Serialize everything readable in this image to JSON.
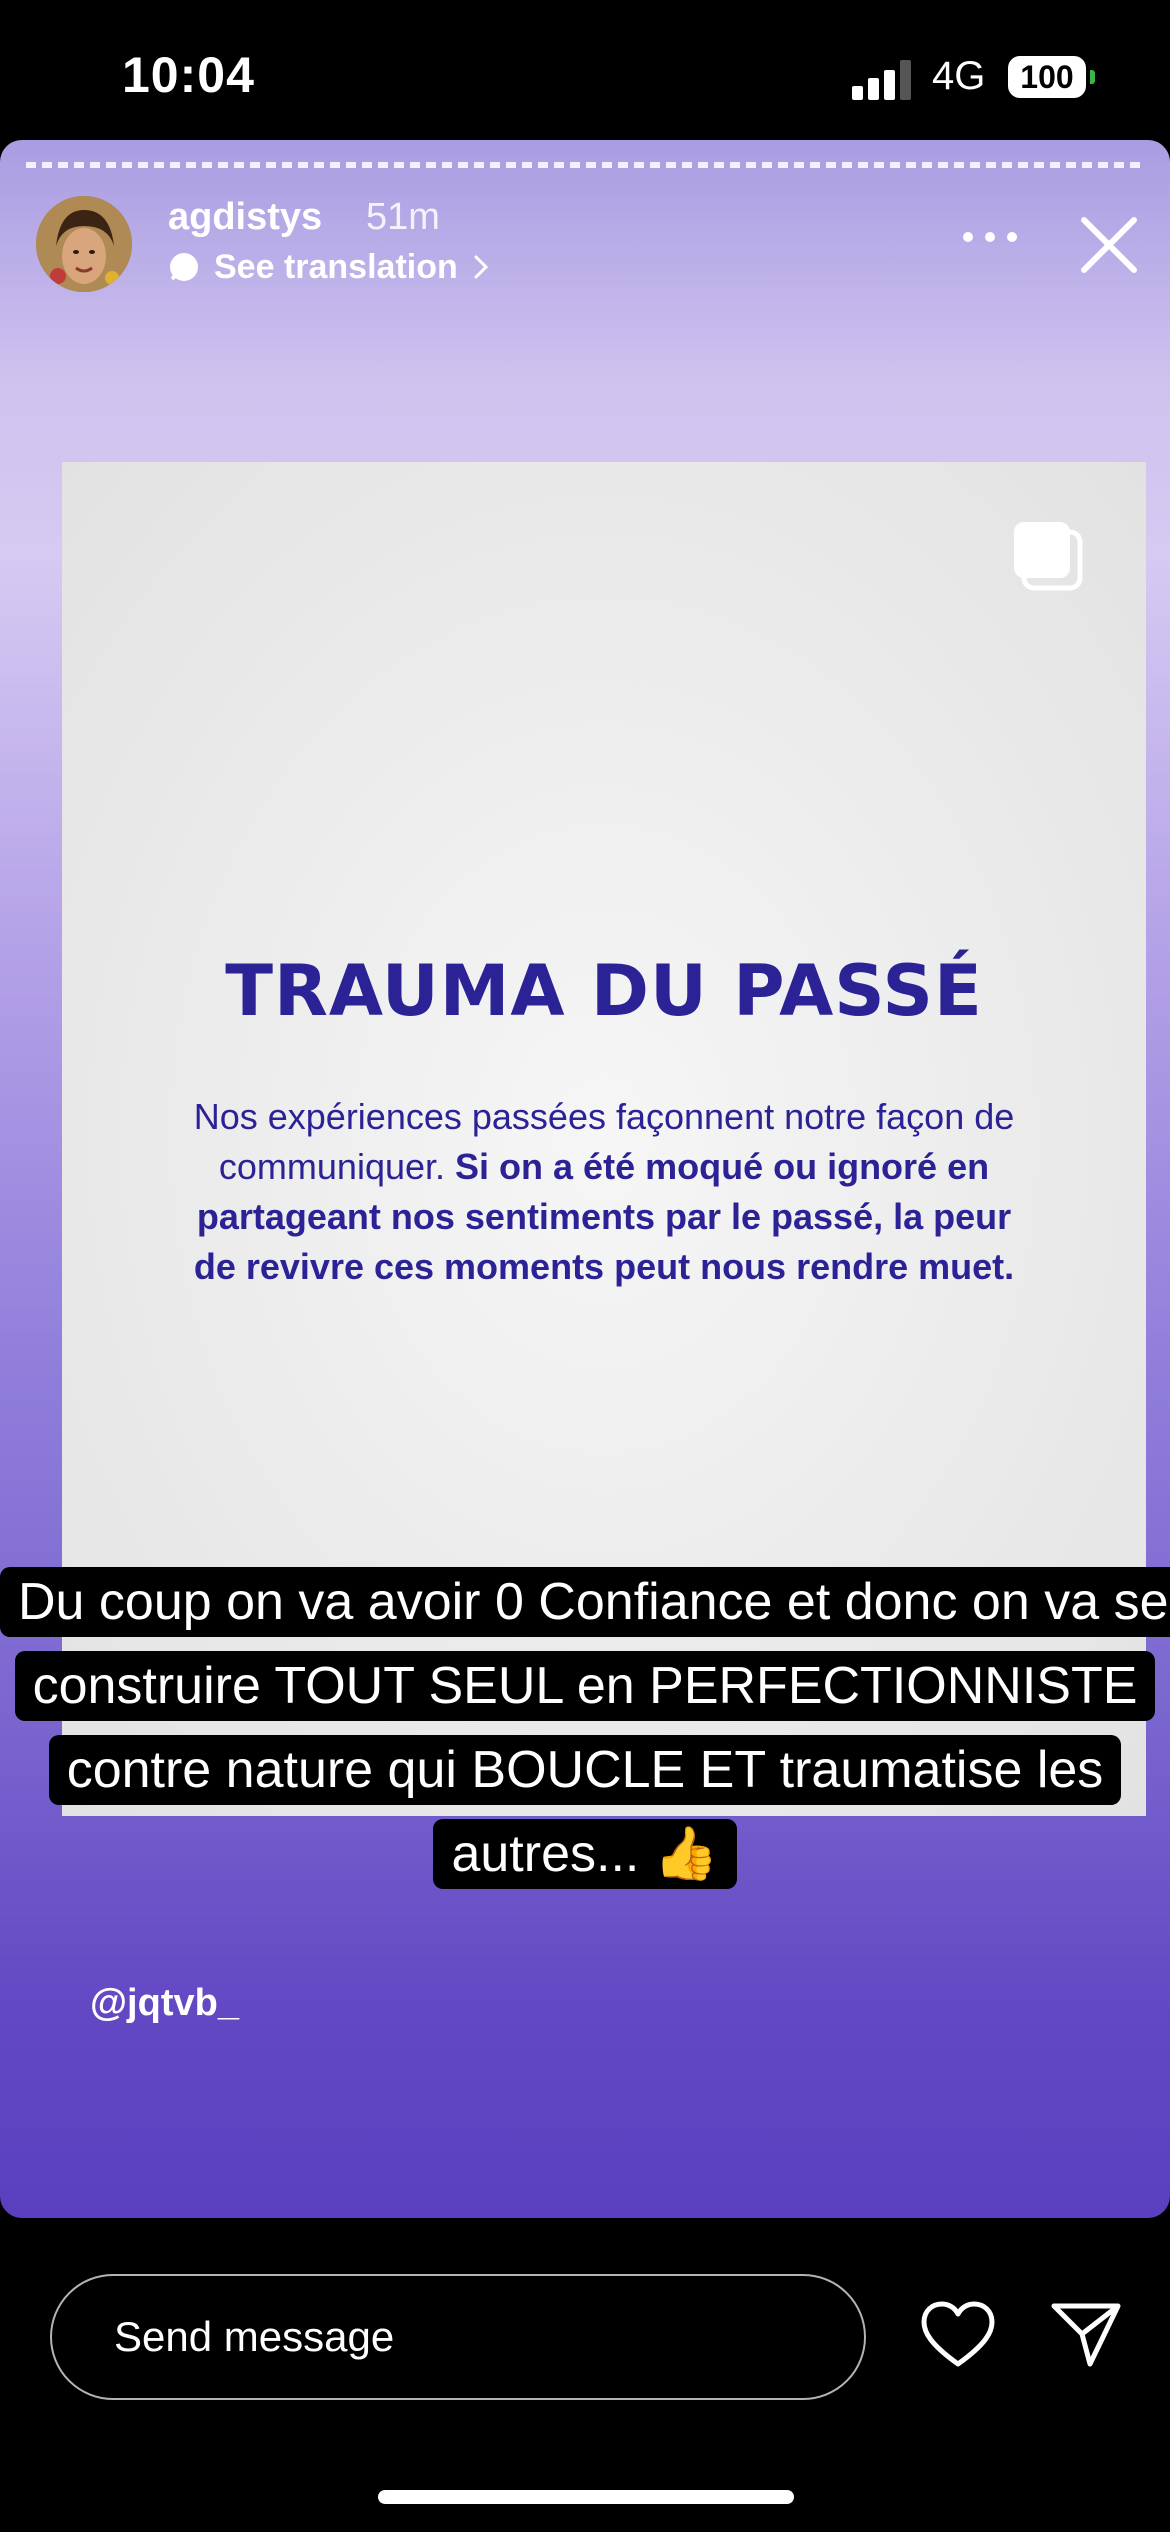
{
  "status_bar": {
    "time": "10:04",
    "network": "4G",
    "battery": "100",
    "icons": [
      "signal-icon",
      "battery-icon"
    ]
  },
  "story": {
    "username": "agdistys",
    "time_ago": "51m",
    "translation_label": "See translation",
    "icons": [
      "avatar",
      "translate-icon",
      "chevron-right-icon",
      "more-icon",
      "close-icon",
      "multi-post-icon"
    ],
    "post": {
      "title": "TRAUMA DU PASSÉ",
      "body_regular": "Nos expériences passées façonnent notre façon de communiquer.",
      "body_bold": "Si on a été moqué ou ignoré en partageant nos sentiments par le passé, la peur de revivre ces moments peut nous rendre muet."
    },
    "caption": "Du coup on va avoir 0 Confiance et donc on va se construire TOUT SEUL en PERFECTIONNISTE contre nature qui BOUCLE ET traumatise les autres... 👍",
    "mention": "@jqtvb_",
    "colors": {
      "title": "#2a2295",
      "gradient_top": "#d6caf2",
      "gradient_bottom": "#5a40bf"
    }
  },
  "bottom_bar": {
    "message_placeholder": "Send message",
    "icons": [
      "heart-icon",
      "send-icon"
    ]
  }
}
